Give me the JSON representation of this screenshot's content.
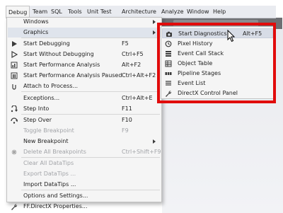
{
  "menubar": {
    "items": [
      "Debug",
      "Team",
      "SQL",
      "Tools",
      "Unit Test",
      "Architecture",
      "Analyze",
      "Window",
      "Help"
    ],
    "active_index": 0
  },
  "debug_menu": {
    "items": [
      {
        "label": "Windows",
        "shortcut": "",
        "icon": "",
        "submenu": true,
        "disabled": false
      },
      {
        "label": "Graphics",
        "shortcut": "",
        "icon": "",
        "submenu": true,
        "disabled": false,
        "highlighted": true
      },
      {
        "label": "Start Debugging",
        "shortcut": "F5",
        "icon": "play-icon",
        "submenu": false,
        "disabled": false
      },
      {
        "label": "Start Without Debugging",
        "shortcut": "Ctrl+F5",
        "icon": "play-outline-icon",
        "submenu": false,
        "disabled": false
      },
      {
        "label": "Start Performance Analysis",
        "shortcut": "Alt+F2",
        "icon": "performance-icon",
        "submenu": false,
        "disabled": false
      },
      {
        "label": "Start Performance Analysis Paused",
        "shortcut": "Ctrl+Alt+F2",
        "icon": "performance-paused-icon",
        "submenu": false,
        "disabled": false
      },
      {
        "label": "Attach to Process...",
        "shortcut": "",
        "icon": "attach-icon",
        "submenu": false,
        "disabled": false
      },
      {
        "label": "Exceptions...",
        "shortcut": "Ctrl+Alt+E",
        "icon": "",
        "submenu": false,
        "disabled": false
      },
      {
        "label": "Step Into",
        "shortcut": "F11",
        "icon": "step-into-icon",
        "submenu": false,
        "disabled": false
      },
      {
        "label": "Step Over",
        "shortcut": "F10",
        "icon": "step-over-icon",
        "submenu": false,
        "disabled": false
      },
      {
        "label": "Toggle Breakpoint",
        "shortcut": "F9",
        "icon": "",
        "submenu": false,
        "disabled": true
      },
      {
        "label": "New Breakpoint",
        "shortcut": "",
        "icon": "",
        "submenu": true,
        "disabled": false
      },
      {
        "label": "Delete All Breakpoints",
        "shortcut": "Ctrl+Shift+F9",
        "icon": "delete-breakpoints-icon",
        "submenu": false,
        "disabled": true
      },
      {
        "label": "Clear All DataTips",
        "shortcut": "",
        "icon": "",
        "submenu": false,
        "disabled": true
      },
      {
        "label": "Export DataTips ...",
        "shortcut": "",
        "icon": "",
        "submenu": false,
        "disabled": true
      },
      {
        "label": "Import DataTips ...",
        "shortcut": "",
        "icon": "",
        "submenu": false,
        "disabled": false
      },
      {
        "label": "Options and Settings...",
        "shortcut": "",
        "icon": "",
        "submenu": false,
        "disabled": false
      },
      {
        "label": "FF.DirectX Properties...",
        "shortcut": "",
        "icon": "wrench-icon",
        "submenu": false,
        "disabled": false
      }
    ]
  },
  "graphics_submenu": {
    "items": [
      {
        "label": "Start Diagnostics",
        "shortcut": "Alt+F5",
        "icon": "camera-icon",
        "highlighted": true
      },
      {
        "label": "Pixel History",
        "shortcut": "",
        "icon": "history-icon"
      },
      {
        "label": "Event Call Stack",
        "shortcut": "",
        "icon": "call-stack-icon"
      },
      {
        "label": "Object Table",
        "shortcut": "",
        "icon": "table-icon"
      },
      {
        "label": "Pipeline Stages",
        "shortcut": "",
        "icon": "pipeline-icon"
      },
      {
        "label": "Event List",
        "shortcut": "",
        "icon": "event-list-icon"
      },
      {
        "label": "DirectX Control Panel",
        "shortcut": "",
        "icon": "wrench-icon"
      }
    ]
  },
  "colors": {
    "highlight_box": "#e10b0b",
    "menu_background": "#f5f5f5",
    "menubar_background": "#e9ebf0",
    "disabled_text": "#a2a4a8"
  }
}
